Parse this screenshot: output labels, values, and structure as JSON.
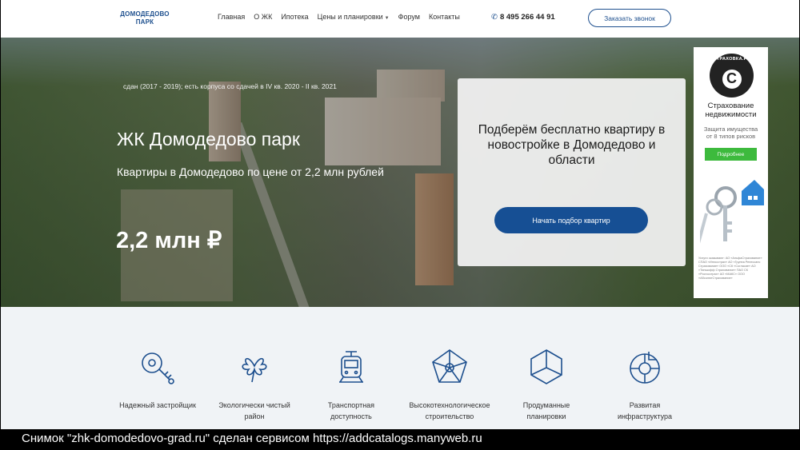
{
  "header": {
    "logo_line1": "ДОМОДЕДОВО",
    "logo_line2": "ПАРК",
    "nav": [
      {
        "label": "Главная"
      },
      {
        "label": "О ЖК"
      },
      {
        "label": "Ипотека"
      },
      {
        "label": "Цены и планировки",
        "has_dropdown": true
      },
      {
        "label": "Форум"
      },
      {
        "label": "Контакты"
      }
    ],
    "phone_icon": "phone-icon",
    "phone": "8 495 266 44 91",
    "callback_label": "Заказать звонок"
  },
  "hero": {
    "subtitle": "сдан (2017 - 2019); есть корпуса со сдачей в IV кв. 2020 - II кв. 2021",
    "title": "ЖК Домодедово парк",
    "description": "Квартиры в Домодедово по цене от 2,2 млн рублей",
    "price": "2,2 млн ₽",
    "card": {
      "title": "Подберём бесплатно квартиру в новостройке в Домодедово и области",
      "button_label": "Начать подбор квартир"
    }
  },
  "ad": {
    "logo_text": "СТРАХОВКА.РУ",
    "logo_letter": "С",
    "title_line1": "Страхование",
    "title_line2": "недвижимости",
    "sub_line1": "Защита имущества",
    "sub_line2": "от 8 типов рисков",
    "button_label": "Подробнее",
    "small_print": "Услуги оказывают: АО «АльфаСтрахование» СПАО «Ингосстрах» АО «Группа Ренессанс Страхование» ООО «СК «Согласие» АО «Тинькофф Страхование» ПАО СК «Росгосстрах» АО «МАКС» ООО «АбсолютСтрахование»"
  },
  "features": [
    {
      "icon": "key-icon",
      "label_line1": "Надежный застройщик",
      "label_line2": ""
    },
    {
      "icon": "clover-icon",
      "label_line1": "Экологически чистый",
      "label_line2": "район"
    },
    {
      "icon": "train-icon",
      "label_line1": "Транспортная",
      "label_line2": "доступность"
    },
    {
      "icon": "pentagon-icon",
      "label_line1": "Высокотехнологическое",
      "label_line2": "строительство"
    },
    {
      "icon": "cube-icon",
      "label_line1": "Продуманные",
      "label_line2": "планировки"
    },
    {
      "icon": "infrastructure-icon",
      "label_line1": "Развитая",
      "label_line2": "инфраструктура"
    }
  ],
  "colors": {
    "brand": "#1d4f8e",
    "button": "#164f94",
    "ad_button": "#3dba3d",
    "features_bg": "#f0f3f6"
  },
  "caption": "Снимок \"zhk-domodedovo-grad.ru\" сделан сервисом https://addcatalogs.manyweb.ru"
}
